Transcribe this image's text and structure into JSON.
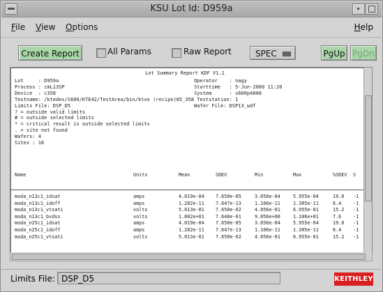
{
  "window": {
    "title": "KSU Lot Id: D959a"
  },
  "menu": {
    "file": "File",
    "view": "View",
    "options": "Options",
    "help": "Help"
  },
  "toolbar": {
    "create_report": "Create Report",
    "all_params": "All Params",
    "raw_report": "Raw Report",
    "spec": "SPEC",
    "pgup": "PgUp",
    "pgdn": "PgDn"
  },
  "report": {
    "title": "Lot Summary Report KDF V1.1",
    "header_lines": [
      "Lot     : D959a                                              Operator    : nagy",
      "Process : cmL13SP                                            Starttime   : 5-Jun-2000 11:20",
      "Device  : c358                                               System      : s600p4000",
      "Testname: /ktedev/S600/KTE42/TestArea/bin/ktxe (recipe)85_358 Teststation: 1",
      "Limits File: DSP_D5                                          Wafer File: DSP13_wdf",
      "? = outside valid limits",
      "# = outside selected limits",
      "* = critical result is outside selected limits",
      ". = site not found",
      "Wafers: 4",
      "Sites : 18"
    ],
    "columns": [
      "Name",
      "Units",
      "Mean",
      "SDEV",
      "Min",
      "Max",
      "%SDEV",
      "S"
    ],
    "rows": [
      [
        "moda_n13c1_idsat",
        "amps",
        "4.019e-04",
        "7.650e-05",
        "3.056e-04",
        "5.955e-04",
        "19.0",
        "-1"
      ],
      [
        "moda_n13c1_idoff",
        "amps",
        "1.202e-11",
        "7.647e-13",
        "1.106e-11",
        "1.305e-11",
        "6.4",
        "-1"
      ],
      [
        "moda_n13c1_vtsati",
        "volts",
        "5.013e-01",
        "7.650e-02",
        "4.056e-01",
        "6.955e-01",
        "15.2",
        "-1"
      ],
      [
        "moda_n13c1_bvdss",
        "volts",
        "1.002e+01",
        "7.648e-01",
        "9.056e+00",
        "1.106e+01",
        "7.6",
        "-1"
      ],
      [
        "moda_n25c1_idsat",
        "amps",
        "4.019e-04",
        "7.650e-05",
        "3.056e-04",
        "5.955e-04",
        "19.0",
        "-1"
      ],
      [
        "moda_n25c1_idoff",
        "amps",
        "1.202e-11",
        "7.647e-13",
        "1.106e-11",
        "1.305e-11",
        "6.4",
        "-1"
      ],
      [
        "moda_n25c1_vtsati",
        "volts",
        "5.013e-01",
        "7.650e-02",
        "4.056e-01",
        "6.955e-01",
        "15.2",
        "-1"
      ]
    ]
  },
  "footer": {
    "limits_label": "Limits File:",
    "limits_value": "DSP_D5",
    "logo": "KEITHLEY"
  },
  "colors": {
    "button_green": "#a9d7a7",
    "logo_red": "#d91f1f"
  }
}
